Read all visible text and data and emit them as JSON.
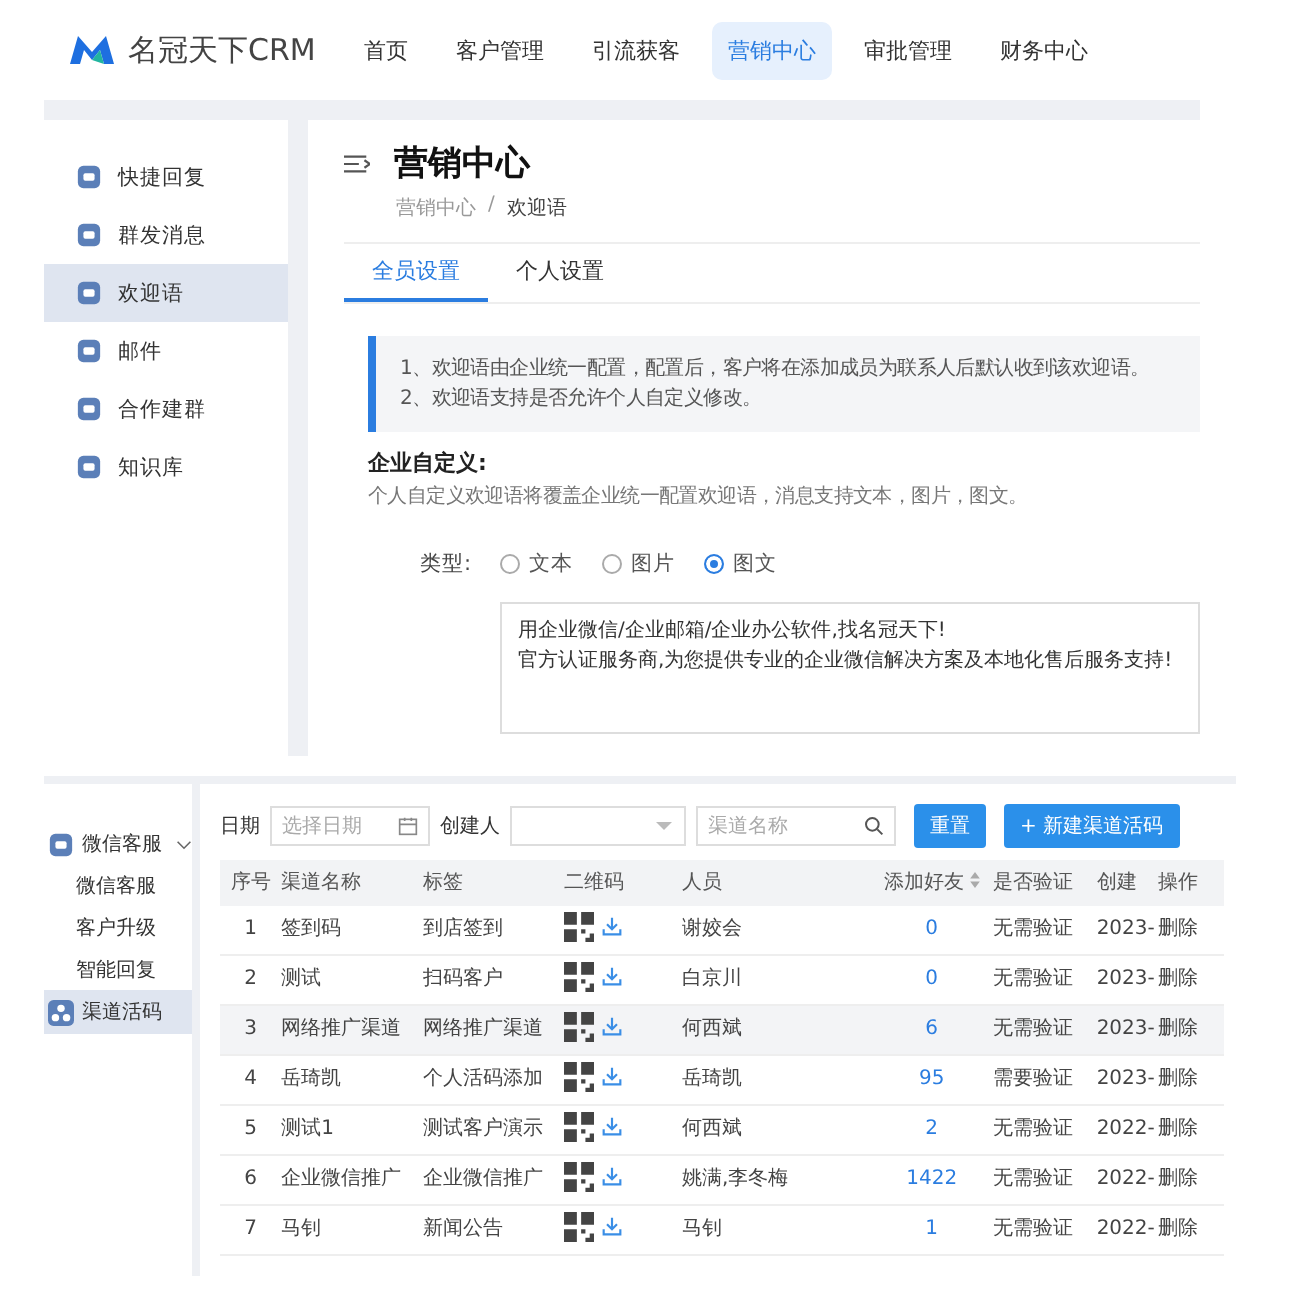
{
  "top": {
    "brand": "名冠天下CRM",
    "nav": [
      {
        "label": "首页",
        "selected": false
      },
      {
        "label": "客户管理",
        "selected": false
      },
      {
        "label": "引流获客",
        "selected": false
      },
      {
        "label": "营销中心",
        "selected": true
      },
      {
        "label": "审批管理",
        "selected": false
      },
      {
        "label": "财务中心",
        "selected": false
      }
    ],
    "sidebar": [
      {
        "label": "快捷回复",
        "selected": false
      },
      {
        "label": "群发消息",
        "selected": false
      },
      {
        "label": "欢迎语",
        "selected": true
      },
      {
        "label": "邮件",
        "selected": false
      },
      {
        "label": "合作建群",
        "selected": false
      },
      {
        "label": "知识库",
        "selected": false
      }
    ],
    "page_title": "营销中心",
    "breadcrumb": [
      "营销中心",
      "欢迎语"
    ],
    "breadcrumb_separator": "/",
    "tabs": [
      {
        "label": "全员设置",
        "selected": true
      },
      {
        "label": "个人设置",
        "selected": false
      }
    ],
    "notice": [
      "1、欢迎语由企业统一配置，配置后，客户将在添加成员为联系人后默认收到该欢迎语。",
      "2、欢迎语支持是否允许个人自定义修改。"
    ],
    "section_title": "企业自定义:",
    "section_hint": "个人自定义欢迎语将覆盖企业统一配置欢迎语，消息支持文本，图片，图文。",
    "type_label": "类型:",
    "types": [
      {
        "label": "文本",
        "selected": false
      },
      {
        "label": "图片",
        "selected": false
      },
      {
        "label": "图文",
        "selected": true
      }
    ],
    "message": "用企业微信/企业邮箱/企业办公软件,找名冠天下!\n官方认证服务商,为您提供专业的企业微信解决方案及本地化售后服务支持!"
  },
  "bottom": {
    "sidebar": {
      "group": {
        "label": "微信客服",
        "expanded": true,
        "children": [
          {
            "label": "微信客服",
            "selected": false
          },
          {
            "label": "客户升级",
            "selected": false
          },
          {
            "label": "智能回复",
            "selected": false
          }
        ]
      },
      "item": {
        "label": "渠道活码",
        "selected": true
      }
    },
    "filters": {
      "date_label": "日期",
      "date_placeholder": "选择日期",
      "creator_label": "创建人",
      "name_placeholder": "渠道名称",
      "reset": "重置",
      "create": "新建渠道活码",
      "create_icon": "+"
    },
    "table": {
      "columns": [
        "序号",
        "渠道名称",
        "标签",
        "二维码",
        "人员",
        "添加好友",
        "是否验证",
        "创建",
        "操作"
      ],
      "rows": [
        {
          "no": "1",
          "name": "签到码",
          "tag": "到店签到",
          "staff": "谢姣会",
          "friends": "0",
          "verify": "无需验证",
          "created": "2023-",
          "action": "删除",
          "selected": false
        },
        {
          "no": "2",
          "name": "测试",
          "tag": "扫码客户",
          "staff": "白京川",
          "friends": "0",
          "verify": "无需验证",
          "created": "2023-",
          "action": "删除",
          "selected": false
        },
        {
          "no": "3",
          "name": "网络推广渠道",
          "tag": "网络推广渠道",
          "staff": "何西斌",
          "friends": "6",
          "verify": "无需验证",
          "created": "2023-",
          "action": "删除",
          "selected": true
        },
        {
          "no": "4",
          "name": "岳琦凯",
          "tag": "个人活码添加",
          "staff": "岳琦凯",
          "friends": "95",
          "verify": "需要验证",
          "created": "2023-",
          "action": "删除",
          "selected": false
        },
        {
          "no": "5",
          "name": "测试1",
          "tag": "测试客户演示",
          "staff": "何西斌",
          "friends": "2",
          "verify": "无需验证",
          "created": "2022-",
          "action": "删除",
          "selected": false
        },
        {
          "no": "6",
          "name": "企业微信推广",
          "tag": "企业微信推广",
          "staff": "姚满,李冬梅",
          "friends": "1422",
          "verify": "无需验证",
          "created": "2022-",
          "action": "删除",
          "selected": false
        },
        {
          "no": "7",
          "name": "马钊",
          "tag": "新闻公告",
          "staff": "马钊",
          "friends": "1",
          "verify": "无需验证",
          "created": "2022-",
          "action": "删除",
          "selected": false
        }
      ]
    }
  }
}
